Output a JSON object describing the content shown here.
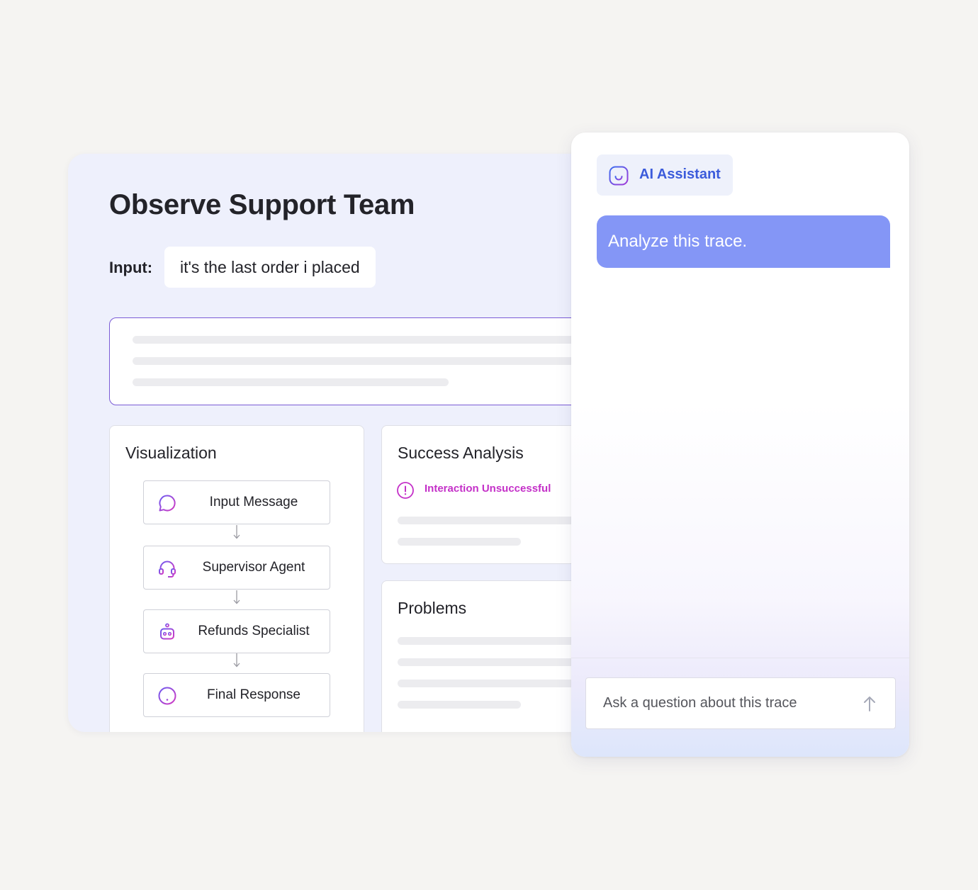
{
  "main": {
    "title": "Observe Support Team",
    "input_label": "Input:",
    "input_value": "it's the last order i placed"
  },
  "visualization": {
    "title": "Visualization",
    "nodes": [
      {
        "label": "Input Message",
        "icon": "message-icon"
      },
      {
        "label": "Supervisor Agent",
        "icon": "headset-icon"
      },
      {
        "label": "Refunds Specialist",
        "icon": "robot-icon"
      },
      {
        "label": "Final Response",
        "icon": "alert-circle-icon"
      }
    ]
  },
  "success_analysis": {
    "title": "Success Analysis",
    "status": "Interaction Unsuccessful",
    "status_icon": "alert-circle-icon"
  },
  "problems": {
    "title": "Problems"
  },
  "assistant": {
    "badge_label": "AI Assistant",
    "badge_icon": "assistant-face-icon",
    "user_message": "Analyze this trace.",
    "input_placeholder": "Ask a question about this trace",
    "send_icon": "arrow-up-icon"
  },
  "colors": {
    "accent_purple": "#c430c8",
    "accent_blue": "#3b5bdb",
    "message_bubble": "#8496f6",
    "panel_background": "#eef0fc"
  }
}
